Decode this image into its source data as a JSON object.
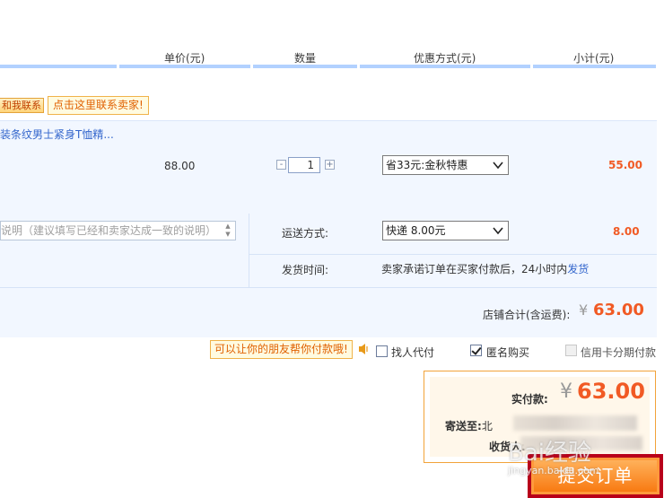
{
  "header": {
    "unit_price": "单价(元)",
    "quantity": "数量",
    "discount": "优惠方式(元)",
    "subtotal": "小计(元)"
  },
  "shop": {
    "contact_button": "和我联系",
    "contact_tip": "点击这里联系卖家!"
  },
  "item": {
    "title": "装条纹男士紧身T恤精...",
    "price": "88.00",
    "qty_minus": "-",
    "qty_plus": "+",
    "quantity": "1",
    "discount_selected": "省33元:金秋特惠",
    "subtotal": "55.00"
  },
  "shipping": {
    "memo_placeholder": "说明（建议填写已经和卖家达成一致的说明）",
    "method_label": "运送方式:",
    "method_selected": "快递 8.00元",
    "fee": "8.00",
    "ship_time_label": "发货时间:",
    "promise_text": "卖家承诺订单在买家付款后，24小时内",
    "promise_link": "发货"
  },
  "shop_total": {
    "label": "店铺合计(含运费):",
    "currency": "¥",
    "value": "63.00"
  },
  "options": {
    "friend_tip": "可以让你的朋友帮你付款哦!",
    "proxy_pay": {
      "label": "找人代付",
      "checked": false
    },
    "anonymous": {
      "label": "匿名购买",
      "checked": true
    },
    "installment": {
      "label": "信用卡分期付款",
      "checked": false,
      "disabled": true
    }
  },
  "summary": {
    "pay_label": "实付款:",
    "currency": "¥",
    "pay_value": "63.00",
    "ship_to_label": "寄送至:",
    "ship_to_value": "北",
    "receiver_label": "收货人:",
    "submit": "提交订单"
  },
  "watermark": {
    "brand": "Bai经验",
    "url": "jingyan.baidu.com"
  },
  "colors": {
    "accent": "#f15a24",
    "link": "#3366cc",
    "header_line": "#b2d1ff",
    "panel_bg": "#f2f7ff",
    "submit_frame": "#b8001a"
  }
}
